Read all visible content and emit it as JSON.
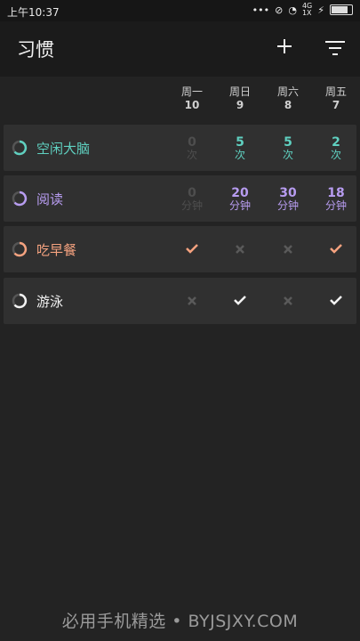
{
  "status": {
    "time": "上午10:37",
    "net": "4G",
    "net_sub": "1X"
  },
  "app": {
    "title": "习惯"
  },
  "days": [
    {
      "name": "周一",
      "num": "10"
    },
    {
      "name": "周日",
      "num": "9"
    },
    {
      "name": "周六",
      "num": "8"
    },
    {
      "name": "周五",
      "num": "7"
    }
  ],
  "habits": [
    {
      "name": "空闲大脑",
      "color": "#5fd0c0",
      "cells": [
        {
          "v": "0",
          "u": "次",
          "dim": true
        },
        {
          "v": "5",
          "u": "次"
        },
        {
          "v": "5",
          "u": "次"
        },
        {
          "v": "2",
          "u": "次"
        }
      ]
    },
    {
      "name": "阅读",
      "color": "#b79cf0",
      "cells": [
        {
          "v": "0",
          "u": "分钟",
          "dim": true
        },
        {
          "v": "20",
          "u": "分钟"
        },
        {
          "v": "30",
          "u": "分钟"
        },
        {
          "v": "18",
          "u": "分钟"
        }
      ]
    },
    {
      "name": "吃早餐",
      "color": "#f5a27f",
      "cells": [
        "check",
        "x",
        "x",
        "check"
      ]
    },
    {
      "name": "游泳",
      "color": "#f2f2f2",
      "cells": [
        "x",
        "check",
        "x",
        "check"
      ]
    }
  ],
  "watermark": "必用手机精选 • BYJSJXY.COM"
}
